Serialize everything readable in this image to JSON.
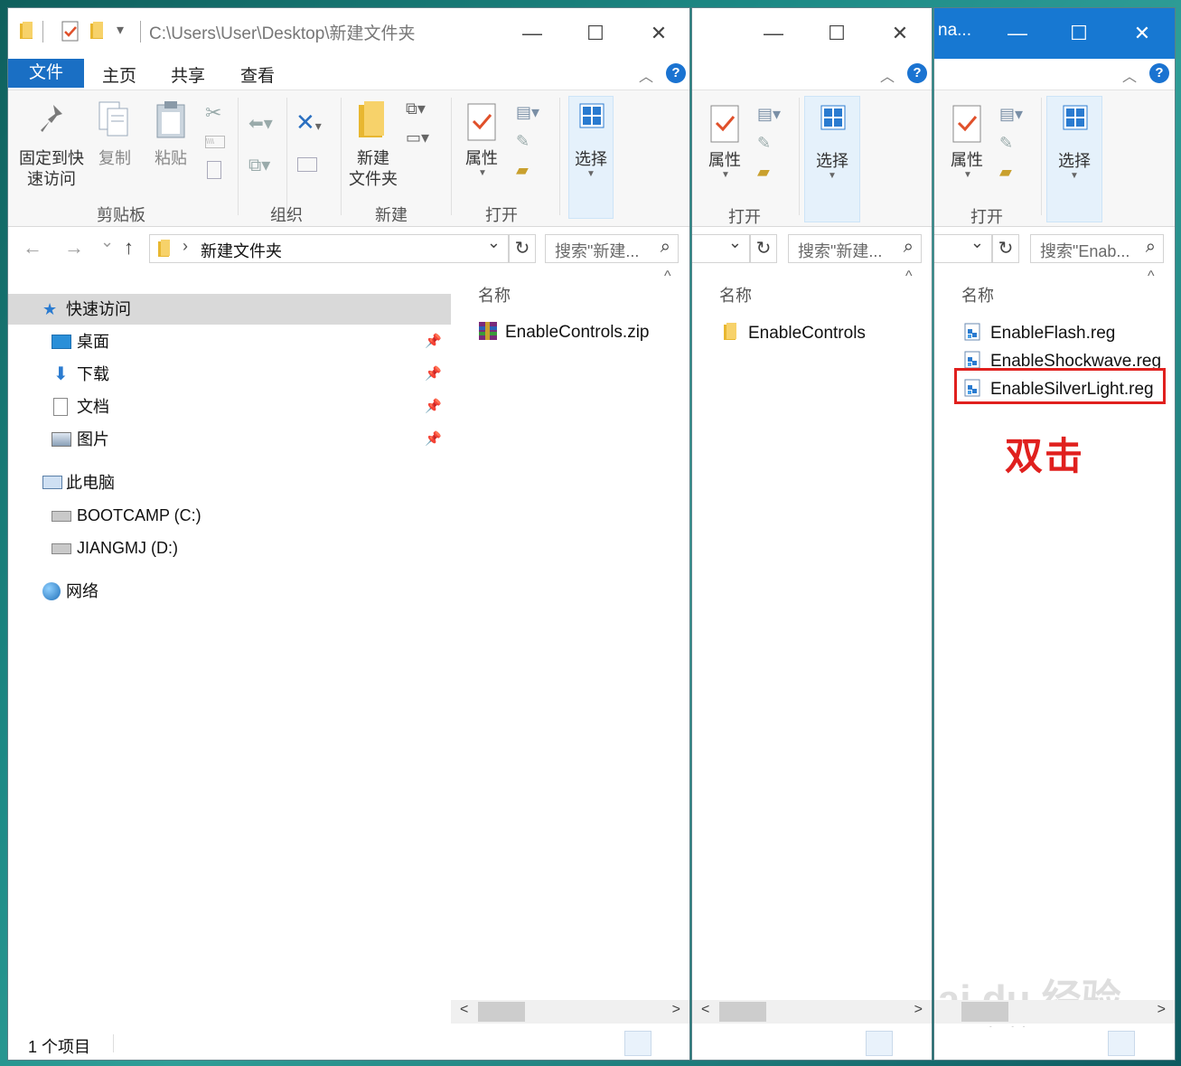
{
  "colors": {
    "accent": "#1778d2",
    "file_tab": "#1a6fc4",
    "highlight_box": "#e0201e",
    "annotation": "#e0201e"
  },
  "left": {
    "title": "C:\\Users\\User\\Desktop\\新建文件夹",
    "tabs": {
      "file": "文件",
      "home": "主页",
      "share": "共享",
      "view": "查看"
    },
    "ribbon": {
      "pin": "固定到快\n速访问",
      "copy": "复制",
      "paste": "粘贴",
      "new_folder": "新建\n文件夹",
      "properties": "属性",
      "select": "选择"
    },
    "groups": {
      "clipboard": "剪贴板",
      "organize": "组织",
      "new": "新建",
      "open": "打开"
    },
    "address": "新建文件夹",
    "search_placeholder": "搜索\"新建...",
    "column": "名称",
    "nav": {
      "quick_access": "快速访问",
      "desktop": "桌面",
      "downloads": "下载",
      "documents": "文档",
      "pictures": "图片",
      "this_pc": "此电脑",
      "drive_c": "BOOTCAMP (C:)",
      "drive_d": "JIANGMJ (D:)",
      "network": "网络"
    },
    "files": [
      "EnableControls.zip"
    ],
    "status": "1 个项目"
  },
  "middle": {
    "ribbon": {
      "properties": "属性",
      "select": "选择"
    },
    "groups": {
      "open": "打开"
    },
    "search_placeholder": "搜索\"新建...",
    "column": "名称",
    "files": [
      "EnableControls"
    ]
  },
  "right": {
    "title": "na...",
    "ribbon": {
      "properties": "属性",
      "select": "选择"
    },
    "groups": {
      "open": "打开"
    },
    "search_placeholder": "搜索\"Enab...",
    "column": "名称",
    "files": [
      "EnableFlash.reg",
      "EnableShockwave.reg",
      "EnableSilverLight.reg"
    ],
    "annotation": "双击"
  },
  "icons": {
    "help": "?",
    "back": "←",
    "forward": "→",
    "up": "↑",
    "refresh": "↻",
    "search": "⌕",
    "chevron_down": "⌄",
    "chevron_right": "›",
    "minimize": "—",
    "maximize": "☐",
    "close": "✕",
    "scroll_left": "<",
    "scroll_right": ">",
    "sort_up": "^",
    "pin": "📌"
  },
  "watermark": {
    "brand": "Bai du 经验",
    "url": "jingyan.baidu.com"
  }
}
